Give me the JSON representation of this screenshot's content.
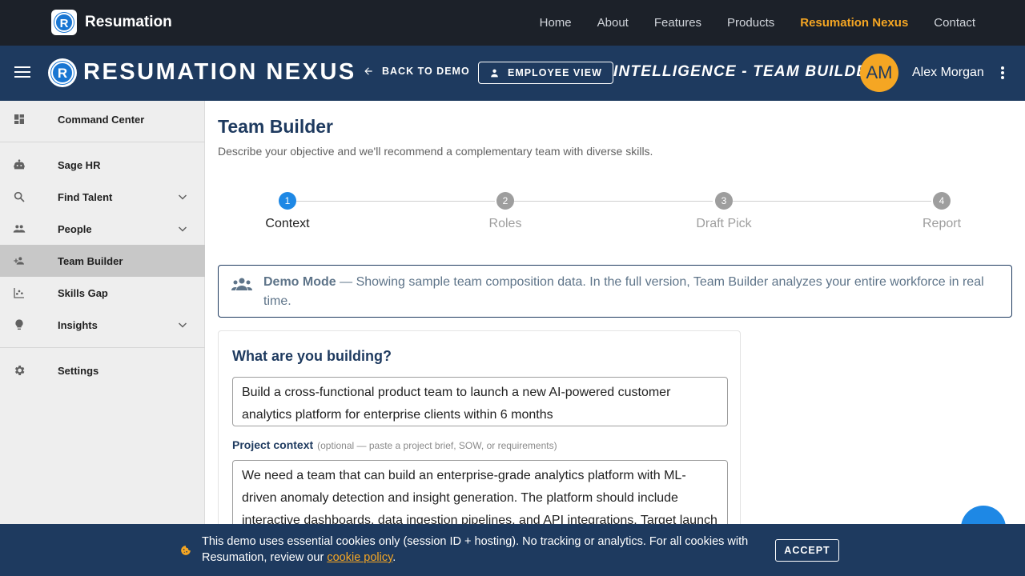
{
  "site": {
    "brand": "Resumation",
    "links": [
      "Home",
      "About",
      "Features",
      "Products",
      "Resumation Nexus",
      "Contact"
    ],
    "active_link": "Resumation Nexus"
  },
  "header": {
    "logo_letter": "R",
    "title": "RESUMATION NEXUS",
    "back_label": "BACK TO DEMO",
    "employee_view_label": "EMPLOYEE VIEW",
    "section_title": "INTELLIGENCE - TEAM BUILDER",
    "avatar_initials": "AM",
    "user_name": "Alex Morgan"
  },
  "sidebar": {
    "items": [
      {
        "label": "Command Center",
        "icon": "dashboard-icon"
      },
      {
        "label": "Sage HR",
        "icon": "robot-icon"
      },
      {
        "label": "Find Talent",
        "icon": "search-icon"
      },
      {
        "label": "People",
        "icon": "people-icon"
      },
      {
        "label": "Team Builder",
        "icon": "group-add-icon"
      },
      {
        "label": "Skills Gap",
        "icon": "scatter-chart-icon"
      },
      {
        "label": "Insights",
        "icon": "lightbulb-icon"
      },
      {
        "label": "Settings",
        "icon": "gear-icon"
      }
    ],
    "active": "Team Builder"
  },
  "main": {
    "title": "Team Builder",
    "subtitle": "Describe your objective and we'll recommend a complementary team with diverse skills.",
    "steps": [
      {
        "num": "1",
        "label": "Context"
      },
      {
        "num": "2",
        "label": "Roles"
      },
      {
        "num": "3",
        "label": "Draft Pick"
      },
      {
        "num": "4",
        "label": "Report"
      }
    ],
    "current_step": 1,
    "demo_banner": {
      "strong": "Demo Mode",
      "text": " — Showing sample team composition data. In the full version, Team Builder analyzes your entire workforce in real time."
    },
    "card": {
      "heading": "What are you building?",
      "objective_value": "Build a cross-functional product team to launch a new AI-powered customer analytics platform for enterprise clients within 6 months",
      "context_label": "Project context",
      "context_hint": "(optional — paste a project brief, SOW, or requirements)",
      "context_value": "We need a team that can build an enterprise-grade analytics platform with ML-driven anomaly detection and insight generation. The platform should include interactive dashboards, data ingestion pipelines, and API integrations. Target launch"
    }
  },
  "cookie": {
    "text": "This demo uses essential cookies only (session ID + hosting). No tracking or analytics. For all cookies with Resumation, review our ",
    "link": "cookie policy",
    "tail": ".",
    "accept_label": "ACCEPT"
  },
  "colors": {
    "nav_bg": "#1c2129",
    "header_bg": "#1e3a5f",
    "accent": "#f5a623",
    "primary": "#1e88e5"
  }
}
